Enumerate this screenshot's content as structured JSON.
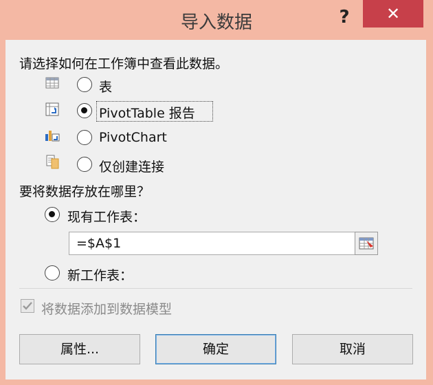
{
  "window": {
    "title": "导入数据",
    "help_glyph": "?",
    "close_glyph": "✕"
  },
  "view": {
    "prompt": "请选择如何在工作簿中查看此数据。",
    "options": [
      {
        "label": "表",
        "selected": false,
        "icon": "table-icon"
      },
      {
        "label": "PivotTable 报告",
        "selected": true,
        "icon": "pivottable-icon"
      },
      {
        "label": "PivotChart",
        "selected": false,
        "icon": "pivotchart-icon"
      },
      {
        "label": "仅创建连接",
        "selected": false,
        "icon": "connection-icon"
      }
    ]
  },
  "location": {
    "prompt": "要将数据存放在哪里？",
    "existing_label": "现有工作表：",
    "existing_selected": true,
    "reference_value": "=$A$1",
    "new_label": "新工作表：",
    "new_selected": false
  },
  "data_model": {
    "label": "将数据添加到数据模型",
    "checked": true,
    "disabled": true
  },
  "buttons": {
    "properties": "属性...",
    "ok": "确定",
    "cancel": "取消"
  },
  "colors": {
    "accent_close": "#c7404a",
    "frame": "#f4b8a4",
    "default_button_border": "#3c7fb1"
  }
}
